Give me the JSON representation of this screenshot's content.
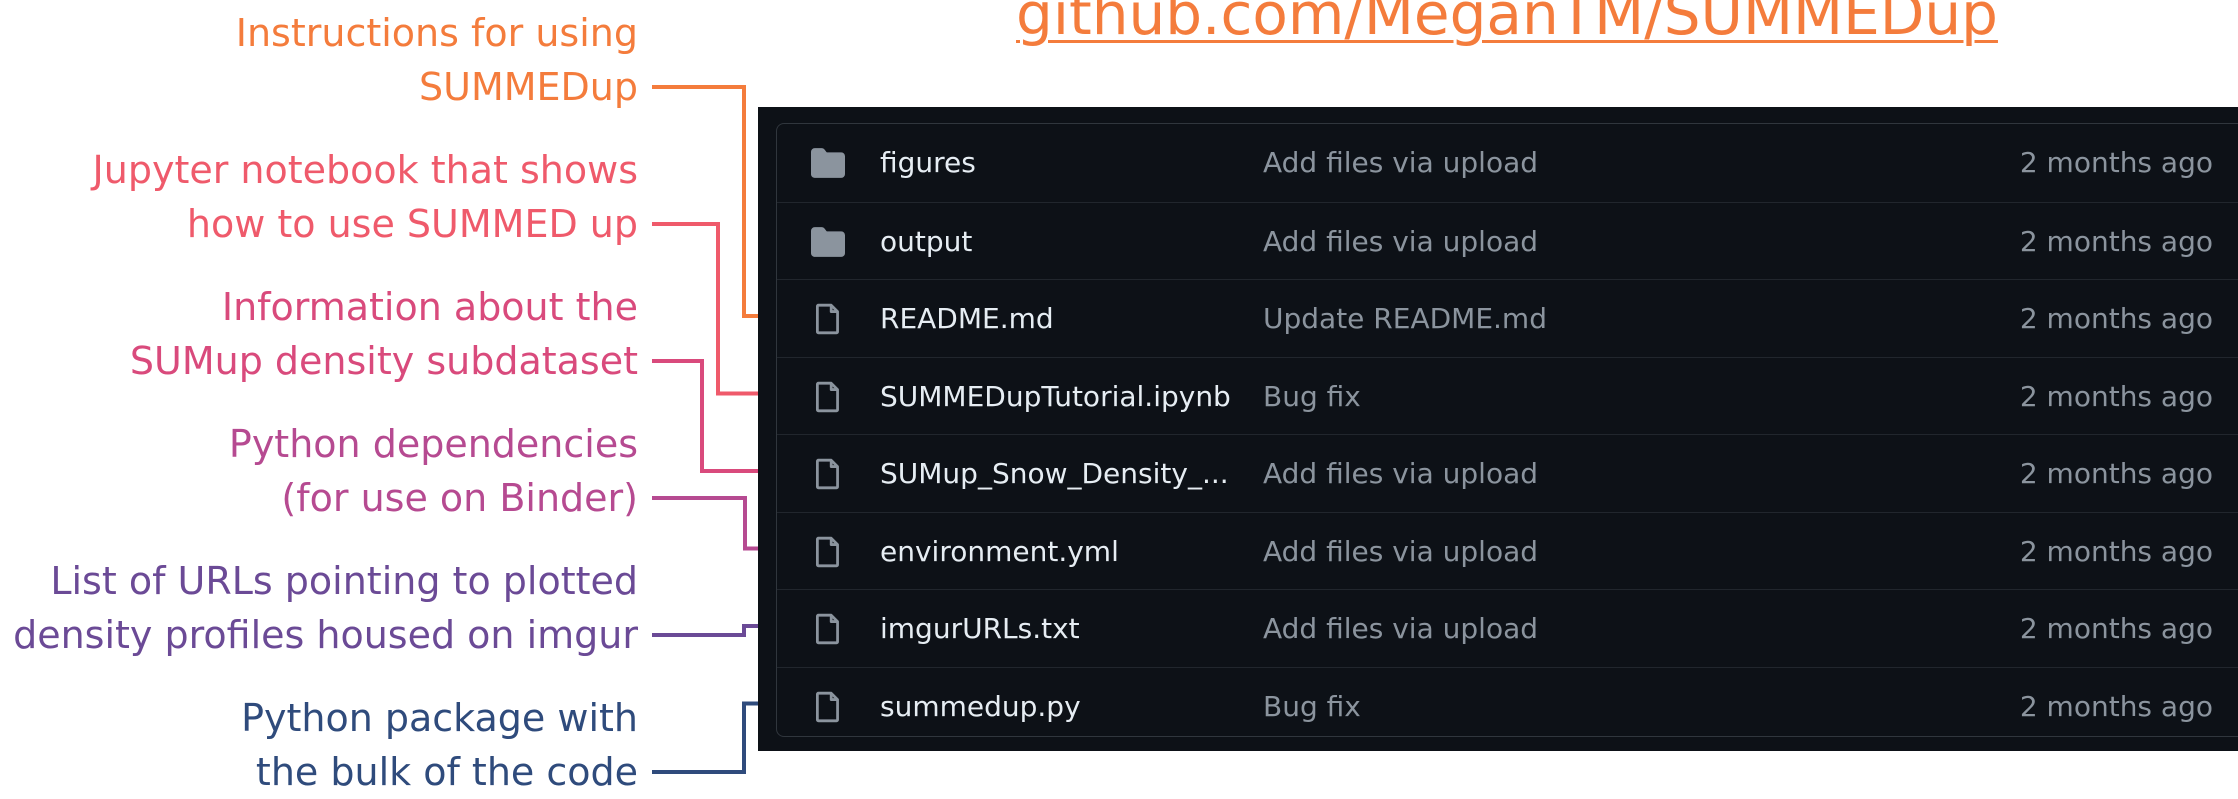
{
  "page": {
    "url": "github.com/MeganTM/SUMMEDup"
  },
  "files": [
    {
      "name": "figures",
      "type": "folder",
      "message": "Add files via upload",
      "age": "2 months ago"
    },
    {
      "name": "output",
      "type": "folder",
      "message": "Add files via upload",
      "age": "2 months ago"
    },
    {
      "name": "README.md",
      "type": "file",
      "message": "Update README.md",
      "age": "2 months ago"
    },
    {
      "name": "SUMMEDupTutorial.ipynb",
      "type": "file",
      "message": "Bug fix",
      "age": "2 months ago"
    },
    {
      "name": "SUMup_Snow_Density_...",
      "type": "file",
      "message": "Add files via upload",
      "age": "2 months ago"
    },
    {
      "name": "environment.yml",
      "type": "file",
      "message": "Add files via upload",
      "age": "2 months ago"
    },
    {
      "name": "imgurURLs.txt",
      "type": "file",
      "message": "Add files via upload",
      "age": "2 months ago"
    },
    {
      "name": "summedup.py",
      "type": "file",
      "message": "Bug fix",
      "age": "2 months ago"
    }
  ],
  "annotations": [
    {
      "line1": "Instructions for using",
      "line2": "SUMMEDup",
      "color": "#f47c3c",
      "target": 2
    },
    {
      "line1": "Jupyter notebook that shows",
      "line2": "how to use SUMMED up",
      "color": "#ef5a6b",
      "target": 3
    },
    {
      "line1": "Information about the",
      "line2": "SUMup density subdataset",
      "color": "#d94a7c",
      "target": 4
    },
    {
      "line1": "Python dependencies",
      "line2": "(for use on Binder)",
      "color": "#b64a91",
      "target": 5
    },
    {
      "line1": "List of URLs pointing to plotted",
      "line2": "density profiles housed on imgur",
      "color": "#6b4a96",
      "target": 6
    },
    {
      "line1": "Python package with",
      "line2": "the bulk of the code",
      "color": "#2f4b7c",
      "target": 7
    }
  ],
  "icons": {
    "folder": "folder-icon",
    "file": "file-icon"
  },
  "colors": {
    "panel_bg": "#0d1117",
    "row_border": "#21262d",
    "file_name": "#e6edf3",
    "muted_text": "#8b949e",
    "icon": "#8b949e"
  }
}
